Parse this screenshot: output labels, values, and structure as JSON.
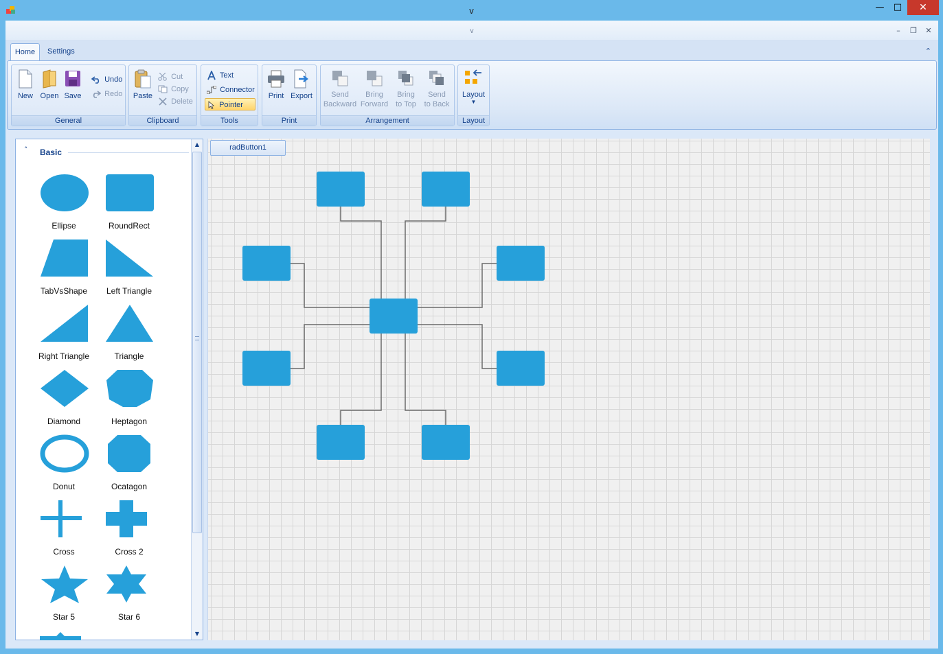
{
  "window": {
    "title": "v",
    "minimize": "—",
    "maximize": "□",
    "close": "✕"
  },
  "inner_window": {
    "title": "v",
    "minimize": "–",
    "restore": "❐",
    "close": "✕"
  },
  "ribbon": {
    "tabs": [
      {
        "label": "Home",
        "selected": true
      },
      {
        "label": "Settings",
        "selected": false
      }
    ],
    "collapse_glyph": "⌃",
    "groups": {
      "general": {
        "label": "General",
        "new": "New",
        "open": "Open",
        "save": "Save",
        "undo": "Undo",
        "redo": "Redo"
      },
      "clipboard": {
        "label": "Clipboard",
        "paste": "Paste",
        "cut": "Cut",
        "copy": "Copy",
        "delete": "Delete"
      },
      "tools": {
        "label": "Tools",
        "text": "Text",
        "connector": "Connector",
        "pointer": "Pointer"
      },
      "print": {
        "label": "Print",
        "print": "Print",
        "export": "Export"
      },
      "arrangement": {
        "label": "Arrangement",
        "send_backward_1": "Send",
        "send_backward_2": "Backward",
        "bring_forward_1": "Bring",
        "bring_forward_2": "Forward",
        "bring_to_top_1": "Bring",
        "bring_to_top_2": "to Top",
        "send_to_back_1": "Send",
        "send_to_back_2": "to Back"
      },
      "layout": {
        "label": "Layout",
        "layout": "Layout"
      }
    }
  },
  "toolbox": {
    "section_title": "Basic",
    "collapse_glyph": "˄",
    "items": [
      {
        "label": "Ellipse",
        "icon": "ellipse-shape"
      },
      {
        "label": "RoundRect",
        "icon": "roundrect-shape"
      },
      {
        "label": "TabVsShape",
        "icon": "tab-shape"
      },
      {
        "label": "Left Triangle",
        "icon": "left-triangle-shape"
      },
      {
        "label": "Right Triangle",
        "icon": "right-triangle-shape"
      },
      {
        "label": "Triangle",
        "icon": "triangle-shape"
      },
      {
        "label": "Diamond",
        "icon": "diamond-shape"
      },
      {
        "label": "Heptagon",
        "icon": "heptagon-shape"
      },
      {
        "label": "Donut",
        "icon": "donut-shape"
      },
      {
        "label": "Ocatagon",
        "icon": "octagon-shape"
      },
      {
        "label": "Cross",
        "icon": "cross-shape"
      },
      {
        "label": "Cross 2",
        "icon": "cross2-shape"
      },
      {
        "label": "Star 5",
        "icon": "star5-shape"
      },
      {
        "label": "Star 6",
        "icon": "star6-shape"
      }
    ]
  },
  "diagram": {
    "button_label": "radButton1",
    "shape_color": "#26a0da",
    "connector_color": "#6b6b6b"
  },
  "colors": {
    "accent": "#26a0da",
    "ribbon_text": "#15428b",
    "close_red": "#c7382b"
  }
}
